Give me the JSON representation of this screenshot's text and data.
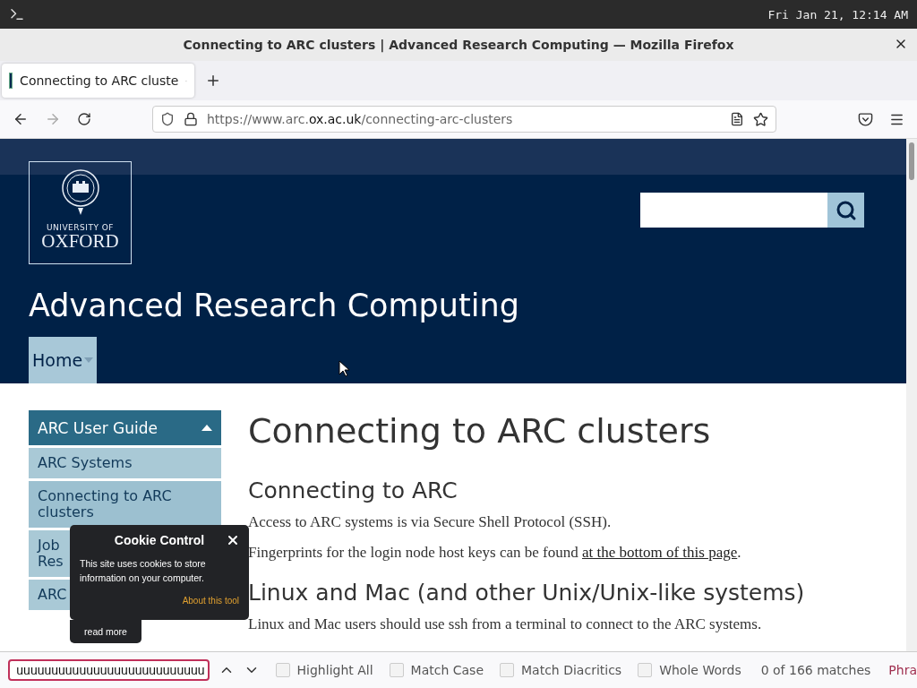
{
  "system_bar": {
    "clock": "Fri Jan 21, 12:14 AM"
  },
  "window": {
    "title": "Connecting to ARC clusters | Advanced Research Computing — Mozilla Firefox"
  },
  "tabs": [
    {
      "label": "Connecting to ARC cluste",
      "selected": true
    }
  ],
  "address_bar": {
    "url_prefix": "https://www.arc.",
    "url_domain": "ox.ac.uk",
    "url_path": "/connecting-arc-clusters"
  },
  "page": {
    "logo": {
      "line_1": "UNIVERSITY OF",
      "line_2": "OXFORD"
    },
    "site_title": "Advanced Research Computing",
    "nav": [
      {
        "label": "Home",
        "selected": true
      }
    ],
    "sidebar": {
      "header": "ARC User Guide",
      "expanded": true,
      "items": [
        {
          "lines": [
            "ARC Systems"
          ],
          "selected": false
        },
        {
          "lines": [
            "Connecting to ARC",
            "clusters"
          ],
          "selected": true
        },
        {
          "lines": [
            "Job",
            "Res"
          ],
          "selected": false
        },
        {
          "lines": [
            "ARC"
          ],
          "selected": false
        }
      ]
    },
    "heading": "Connecting to ARC clusters",
    "sections": [
      {
        "kind": "h2",
        "text": "Connecting to ARC"
      },
      {
        "kind": "p",
        "text": "Access to ARC systems is via Secure Shell Protocol (SSH)."
      },
      {
        "kind": "p",
        "text": "Fingerprints for the login node host keys can be found ",
        "link": "at the bottom of this page",
        "after": "."
      },
      {
        "kind": "h2",
        "text": "Linux and Mac (and other Unix/Unix-like systems)"
      },
      {
        "kind": "p",
        "text": "Linux and Mac users should use ssh from a terminal to connect to the ARC systems."
      }
    ]
  },
  "cookie_popup": {
    "title": "Cookie Control",
    "text": "This site uses cookies to store information on your computer.",
    "link": "About this tool",
    "read_more": "read more"
  },
  "find_bar": {
    "value": "uuuuuuuuuuuuuuuuuuuuuuuuuuu",
    "options": [
      {
        "label": "Highlight All",
        "checked": false
      },
      {
        "label": "Match Case",
        "checked": false
      },
      {
        "label": "Match Diacritics",
        "checked": false
      },
      {
        "label": "Whole Words",
        "checked": false
      }
    ],
    "status": "0 of 166 matches",
    "extra": "Phra"
  }
}
